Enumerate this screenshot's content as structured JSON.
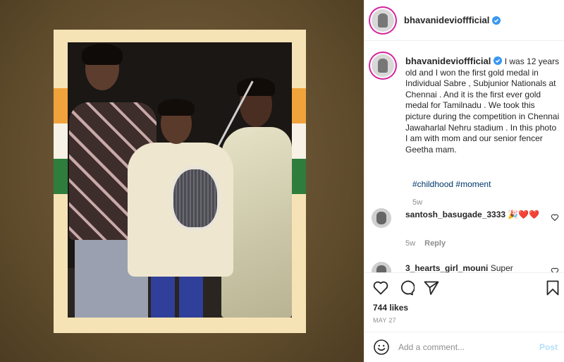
{
  "post": {
    "username": "bhavanidevioffficial",
    "caption": "I was 12 years old and I won the first gold medal in Individual Sabre , Subjunior Nationals at Chennai . And it is the first ever gold medal for Tamilnadu . We took this picture during the competition in Chennai Jawaharlal Nehru stadium . In this photo I am with mom and our senior fencer Geetha mam.",
    "hashtags": [
      "#childhood",
      "#moment"
    ],
    "caption_time": "5w",
    "likes": "744 likes",
    "date": "MAY 27"
  },
  "comments": [
    {
      "username": "santosh_basugade_3333",
      "text": "",
      "emoji": "🎉❤️❤️",
      "time": "5w",
      "reply_label": "Reply"
    },
    {
      "username": "3_hearts_girl_mouni",
      "text": "Super",
      "emoji": "",
      "time": "",
      "reply_label": ""
    }
  ],
  "composer": {
    "placeholder": "Add a comment...",
    "post_label": "Post"
  },
  "icons": {
    "verified": "verified-badge-icon",
    "like": "heart-icon",
    "comment": "comment-bubble-icon",
    "share": "paper-plane-icon",
    "save": "bookmark-icon",
    "emoji": "smiley-icon"
  },
  "colors": {
    "accent_link": "#00376b",
    "verified_blue": "#3897f0",
    "post_button_disabled": "#b2dffc",
    "muted": "#8e8e8e"
  }
}
